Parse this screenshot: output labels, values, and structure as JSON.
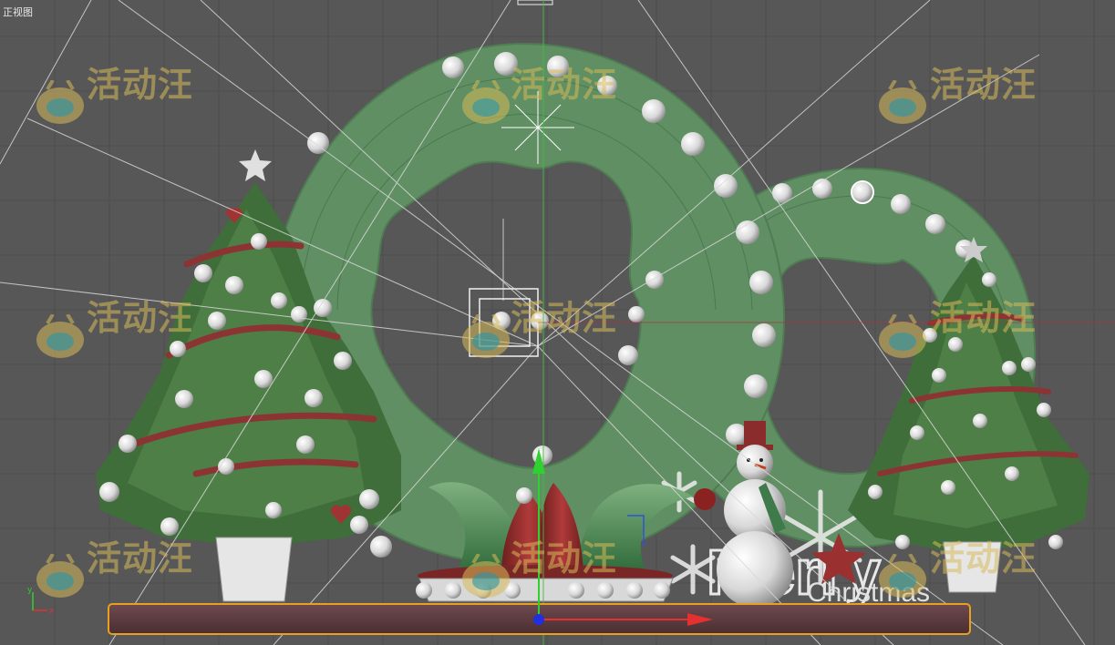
{
  "viewport": {
    "label": "正视图"
  },
  "watermark": {
    "text": "活动汪"
  },
  "scene_text": {
    "merry": "Merry",
    "christmas": "Christmas"
  },
  "colors": {
    "background": "#575757",
    "wreath": "#5f8f62",
    "tree": "#3f6e3a",
    "ribbon": "#8c3434",
    "ornament": "#e6e6e6",
    "base_bar": "#5a3a3e",
    "selection": "#e8a020",
    "axis_x": "#e53030",
    "axis_y": "#30d030",
    "axis_z": "#3050e0"
  }
}
